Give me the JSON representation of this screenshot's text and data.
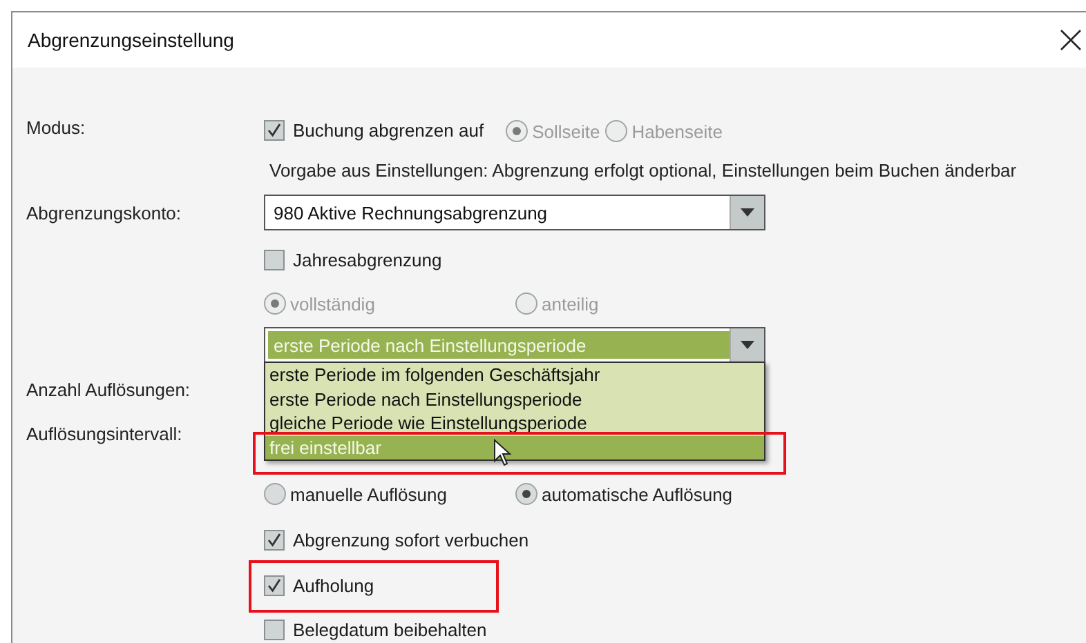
{
  "window": {
    "title": "Abgrenzungseinstellung"
  },
  "form": {
    "modus": {
      "label": "Modus:",
      "checkbox": {
        "label": "Buchung abgrenzen auf",
        "checked": true
      },
      "sides": [
        {
          "label": "Sollseite",
          "selected": true,
          "disabled": true
        },
        {
          "label": "Habenseite",
          "selected": false,
          "disabled": true
        }
      ],
      "note": "Vorgabe aus Einstellungen: Abgrenzung erfolgt optional, Einstellungen beim Buchen änderbar"
    },
    "konto": {
      "label": "Abgrenzungskonto:",
      "value": "980 Aktive Rechnungsabgrenzung"
    },
    "jahresabgrenzung": {
      "label": "Jahresabgrenzung",
      "checked": false
    },
    "scope": [
      {
        "label": "vollständig",
        "selected": true,
        "disabled": true
      },
      {
        "label": "anteilig",
        "selected": false,
        "disabled": true
      }
    ],
    "period": {
      "value": "erste Periode nach Einstellungsperiode",
      "expanded": true,
      "options": [
        {
          "label": "erste Periode im folgenden Geschäftsjahr",
          "hovered": false,
          "highlighted": false
        },
        {
          "label": "erste Periode nach Einstellungsperiode",
          "hovered": false,
          "highlighted": false
        },
        {
          "label": "gleiche Periode wie Einstellungsperiode",
          "hovered": false,
          "highlighted": false
        },
        {
          "label": "frei einstellbar",
          "hovered": true,
          "highlighted": true
        }
      ]
    },
    "anzahl_label": "Anzahl Auflösungen:",
    "intervall_label": "Auflösungsintervall:",
    "mode": [
      {
        "label": "manuelle Auflösung",
        "selected": false,
        "disabled": false
      },
      {
        "label": "automatische Auflösung",
        "selected": true,
        "disabled": false
      }
    ],
    "options": [
      {
        "label": "Abgrenzung sofort verbuchen",
        "checked": true,
        "highlighted": false
      },
      {
        "label": "Aufholung",
        "checked": true,
        "highlighted": true
      },
      {
        "label": "Belegdatum beibehalten",
        "checked": false,
        "highlighted": false
      }
    ]
  }
}
